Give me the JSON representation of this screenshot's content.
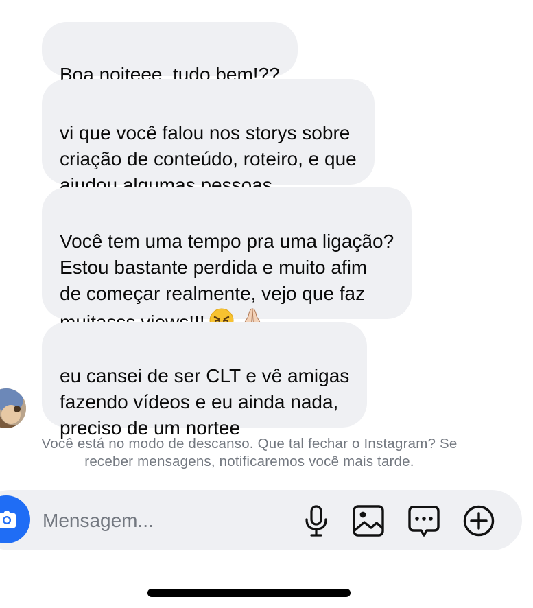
{
  "thread": {
    "messages": [
      {
        "text": "Boa noiteee, tudo bem!??"
      },
      {
        "text": "vi que você falou nos storys sobre\ncriação de conteúdo, roteiro, e que\najudou algumas pessoas..."
      },
      {
        "text": "Você tem uma tempo pra uma ligação?\nEstou bastante perdida e muito afim\nde começar realmente, vejo que faz\nmuitasss views!!!"
      },
      {
        "text": "eu cansei de ser CLT e vê amigas\nfazendo vídeos e eu ainda nada,\npreciso de um nortee"
      }
    ],
    "emojis": [
      "weary-face",
      "folded-hands"
    ]
  },
  "rest_mode": {
    "line1": "Você está no modo de descanso. Que tal fechar o Instagram? Se",
    "line2": "receber mensagens, notificaremos você mais tarde."
  },
  "composer": {
    "placeholder": "Mensagem...",
    "icons": [
      "camera-icon",
      "microphone-icon",
      "gallery-icon",
      "sticker-icon",
      "plus-icon"
    ]
  },
  "colors": {
    "bubble_bg": "#eff0f3",
    "camera_accent": "#1f6df5",
    "muted_text": "#737880"
  }
}
